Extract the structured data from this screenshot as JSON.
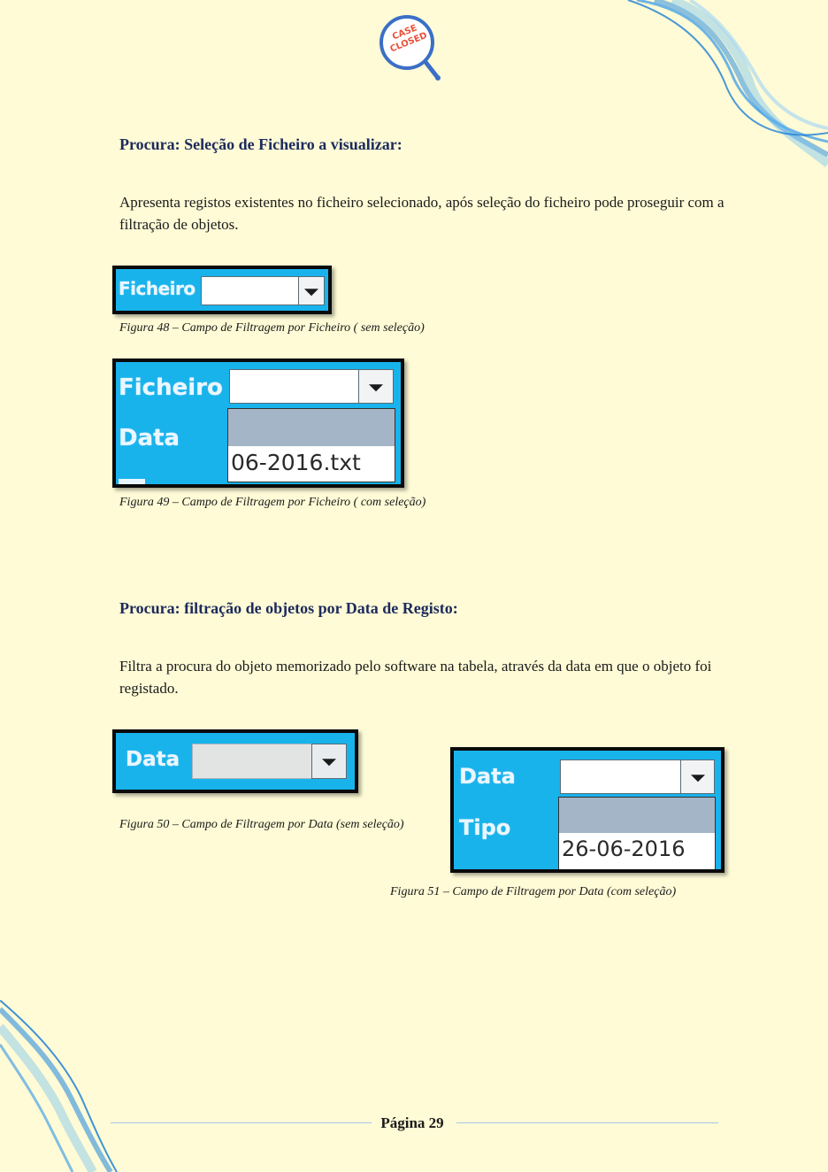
{
  "logo": {
    "line1": "CASE",
    "line2": "CLOSED"
  },
  "section1": {
    "heading": "Procura: Seleção de Ficheiro a visualizar:",
    "paragraph": "Apresenta registos existentes no ficheiro selecionado, após seleção do ficheiro pode proseguir com a filtração de objetos."
  },
  "fig48": {
    "label": "Ficheiro",
    "caption": "Figura 48 – Campo de Filtragem por Ficheiro ( sem seleção)"
  },
  "fig49": {
    "label_ficheiro": "Ficheiro",
    "label_data": "Data",
    "option": "06-2016.txt",
    "caption": "Figura 49 – Campo de Filtragem por Ficheiro ( com seleção)"
  },
  "section2": {
    "heading": "Procura: filtração de objetos por Data de Registo:",
    "paragraph": "Filtra a procura do objeto memorizado pelo software na tabela, através da data em que o objeto foi registado."
  },
  "fig50": {
    "label": "Data",
    "caption": "Figura 50 – Campo de Filtragem por Data (sem seleção)"
  },
  "fig51": {
    "label_data": "Data",
    "label_tipo": "Tipo",
    "option": "26-06-2016",
    "caption": "Figura 51 – Campo de Filtragem por Data (com seleção)"
  },
  "footer": {
    "page": "Página 29"
  },
  "colors": {
    "background": "#fefbd6",
    "heading": "#1c2a5c",
    "panel": "#19b3ec",
    "logo_ring": "#3b6fc6",
    "logo_text": "#e8503a"
  }
}
